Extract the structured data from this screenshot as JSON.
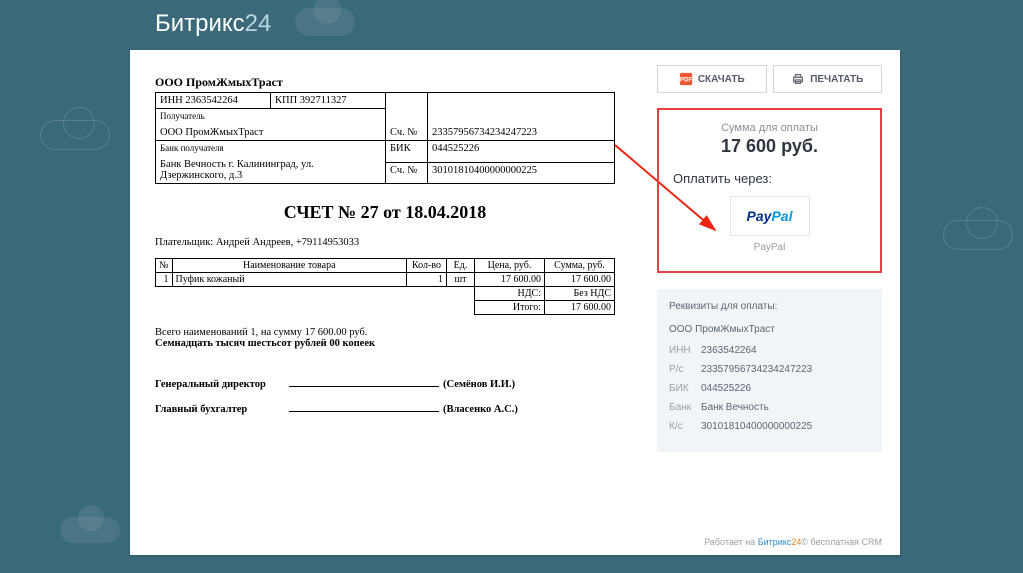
{
  "brand": {
    "name": "Битрикс",
    "suffix": "24"
  },
  "buttons": {
    "download": "СКАЧАТЬ",
    "print": "ПЕЧАТАТЬ"
  },
  "amount": {
    "label": "Сумма для оплаты",
    "value": "17 600 руб."
  },
  "payvia": {
    "label": "Оплатить через:",
    "tile1": "Pay",
    "tile2": "Pal",
    "name": "PayPal"
  },
  "requisites": {
    "title": "Реквизиты для оплаты:",
    "org": "ООО ПромЖмыхТраст",
    "rows": [
      {
        "k": "ИНН",
        "v": "2363542264"
      },
      {
        "k": "Р/с",
        "v": "23357956734234247223"
      },
      {
        "k": "БИК",
        "v": "044525226"
      },
      {
        "k": "Банк",
        "v": "Банк Вечность"
      },
      {
        "k": "К/с",
        "v": "30101810400000000225"
      }
    ]
  },
  "doc": {
    "company": "ООО ПромЖмыхТраст",
    "inn": "ИНН 2363542264",
    "kpp": "КПП 392711327",
    "recipient_lbl": "Получатель",
    "recipient": "ООО ПромЖмыхТраст",
    "acct_lbl": "Сч. №",
    "acct": "23357956734234247223",
    "bank_lbl": "Банк получателя",
    "bank": "Банк Вечность г. Калининград, ул. Дзержинского, д.3",
    "bik_lbl": "БИК",
    "bik": "044525226",
    "corr_lbl": "Сч. №",
    "corr": "30101810400000000225",
    "title": "СЧЕТ № 27 от 18.04.2018",
    "payer": "Плательщик: Андрей Андреев, +79114953033",
    "th": {
      "n": "№",
      "name": "Наименование товара",
      "qty": "Кол-во",
      "unit": "Ед.",
      "price": "Цена, руб.",
      "sum": "Сумма, руб."
    },
    "row": {
      "n": "1",
      "name": "Пуфик кожаный",
      "qty": "1",
      "unit": "шт",
      "price": "17 600.00",
      "sum": "17 600.00"
    },
    "vat_lbl": "НДС:",
    "vat_val": "Без НДС",
    "total_lbl": "Итого:",
    "total_val": "17 600.00",
    "summary1": "Всего наименований 1, на сумму 17 600.00 руб.",
    "summary2": "Семнадцать тысяч шестьсот рублей 00 копеек",
    "sig1_role": "Генеральный директор",
    "sig1_name": "(Семёнов И.И.)",
    "sig2_role": "Главный бухгалтер",
    "sig2_name": "(Власенко А.С.)"
  },
  "footer": {
    "prefix": "Работает на",
    "brand": "Битрикс",
    "suffix": "24",
    "copy": "©",
    "tail": "бесплатная CRM"
  }
}
